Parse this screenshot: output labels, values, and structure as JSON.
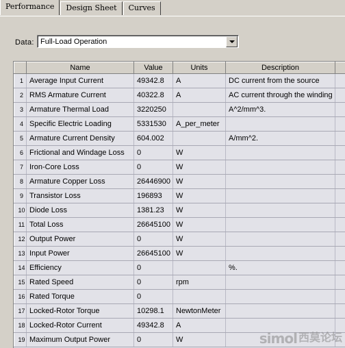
{
  "tabs": [
    {
      "label": "Performance",
      "active": true
    },
    {
      "label": "Design Sheet",
      "active": false
    },
    {
      "label": "Curves",
      "active": false
    }
  ],
  "data_selector": {
    "label": "Data:",
    "value": "Full-Load Operation",
    "placeholder": "Full-Load Operation",
    "dropdown_icon": "chevron-down-icon"
  },
  "grid": {
    "columns": [
      "",
      "Name",
      "Value",
      "Units",
      "Description",
      ""
    ],
    "rows": [
      {
        "n": "1",
        "name": "Average Input Current",
        "value": "49342.8",
        "units": "A",
        "desc": "DC current from the source"
      },
      {
        "n": "2",
        "name": "RMS Armature Current",
        "value": "40322.8",
        "units": "A",
        "desc": "AC current through the winding"
      },
      {
        "n": "3",
        "name": "Armature Thermal Load",
        "value": "3220250",
        "units": "",
        "desc": "A^2/mm^3."
      },
      {
        "n": "4",
        "name": "Specific Electric Loading",
        "value": "5331530",
        "units": "A_per_meter",
        "desc": ""
      },
      {
        "n": "5",
        "name": "Armature Current Density",
        "value": "604.002",
        "units": "",
        "desc": "A/mm^2."
      },
      {
        "n": "6",
        "name": "Frictional and Windage Loss",
        "value": "0",
        "units": "W",
        "desc": ""
      },
      {
        "n": "7",
        "name": "Iron-Core Loss",
        "value": "0",
        "units": "W",
        "desc": ""
      },
      {
        "n": "8",
        "name": "Armature Copper Loss",
        "value": "26446900",
        "units": "W",
        "desc": ""
      },
      {
        "n": "9",
        "name": "Transistor Loss",
        "value": "196893",
        "units": "W",
        "desc": ""
      },
      {
        "n": "10",
        "name": "Diode Loss",
        "value": "1381.23",
        "units": "W",
        "desc": ""
      },
      {
        "n": "11",
        "name": "Total Loss",
        "value": "26645100",
        "units": "W",
        "desc": ""
      },
      {
        "n": "12",
        "name": "Output Power",
        "value": "0",
        "units": "W",
        "desc": ""
      },
      {
        "n": "13",
        "name": "Input Power",
        "value": "26645100",
        "units": "W",
        "desc": ""
      },
      {
        "n": "14",
        "name": "Efficiency",
        "value": "0",
        "units": "",
        "desc": "%."
      },
      {
        "n": "15",
        "name": "Rated Speed",
        "value": "0",
        "units": "rpm",
        "desc": ""
      },
      {
        "n": "16",
        "name": "Rated Torque",
        "value": "0",
        "units": "",
        "desc": ""
      },
      {
        "n": "17",
        "name": "Locked-Rotor Torque",
        "value": "10298.1",
        "units": "NewtonMeter",
        "desc": ""
      },
      {
        "n": "18",
        "name": "Locked-Rotor Current",
        "value": "49342.8",
        "units": "A",
        "desc": ""
      },
      {
        "n": "19",
        "name": "Maximum Output Power",
        "value": "0",
        "units": "W",
        "desc": ""
      }
    ]
  },
  "watermark": {
    "brand": "simol",
    "brand_cn": "西莫论坛"
  },
  "colors": {
    "window_face": "#d4d0c8",
    "grid_cell": "#e2e2e8",
    "grid_line": "#a8a8b4",
    "text": "#000000",
    "watermark": "#8a8a8a"
  }
}
